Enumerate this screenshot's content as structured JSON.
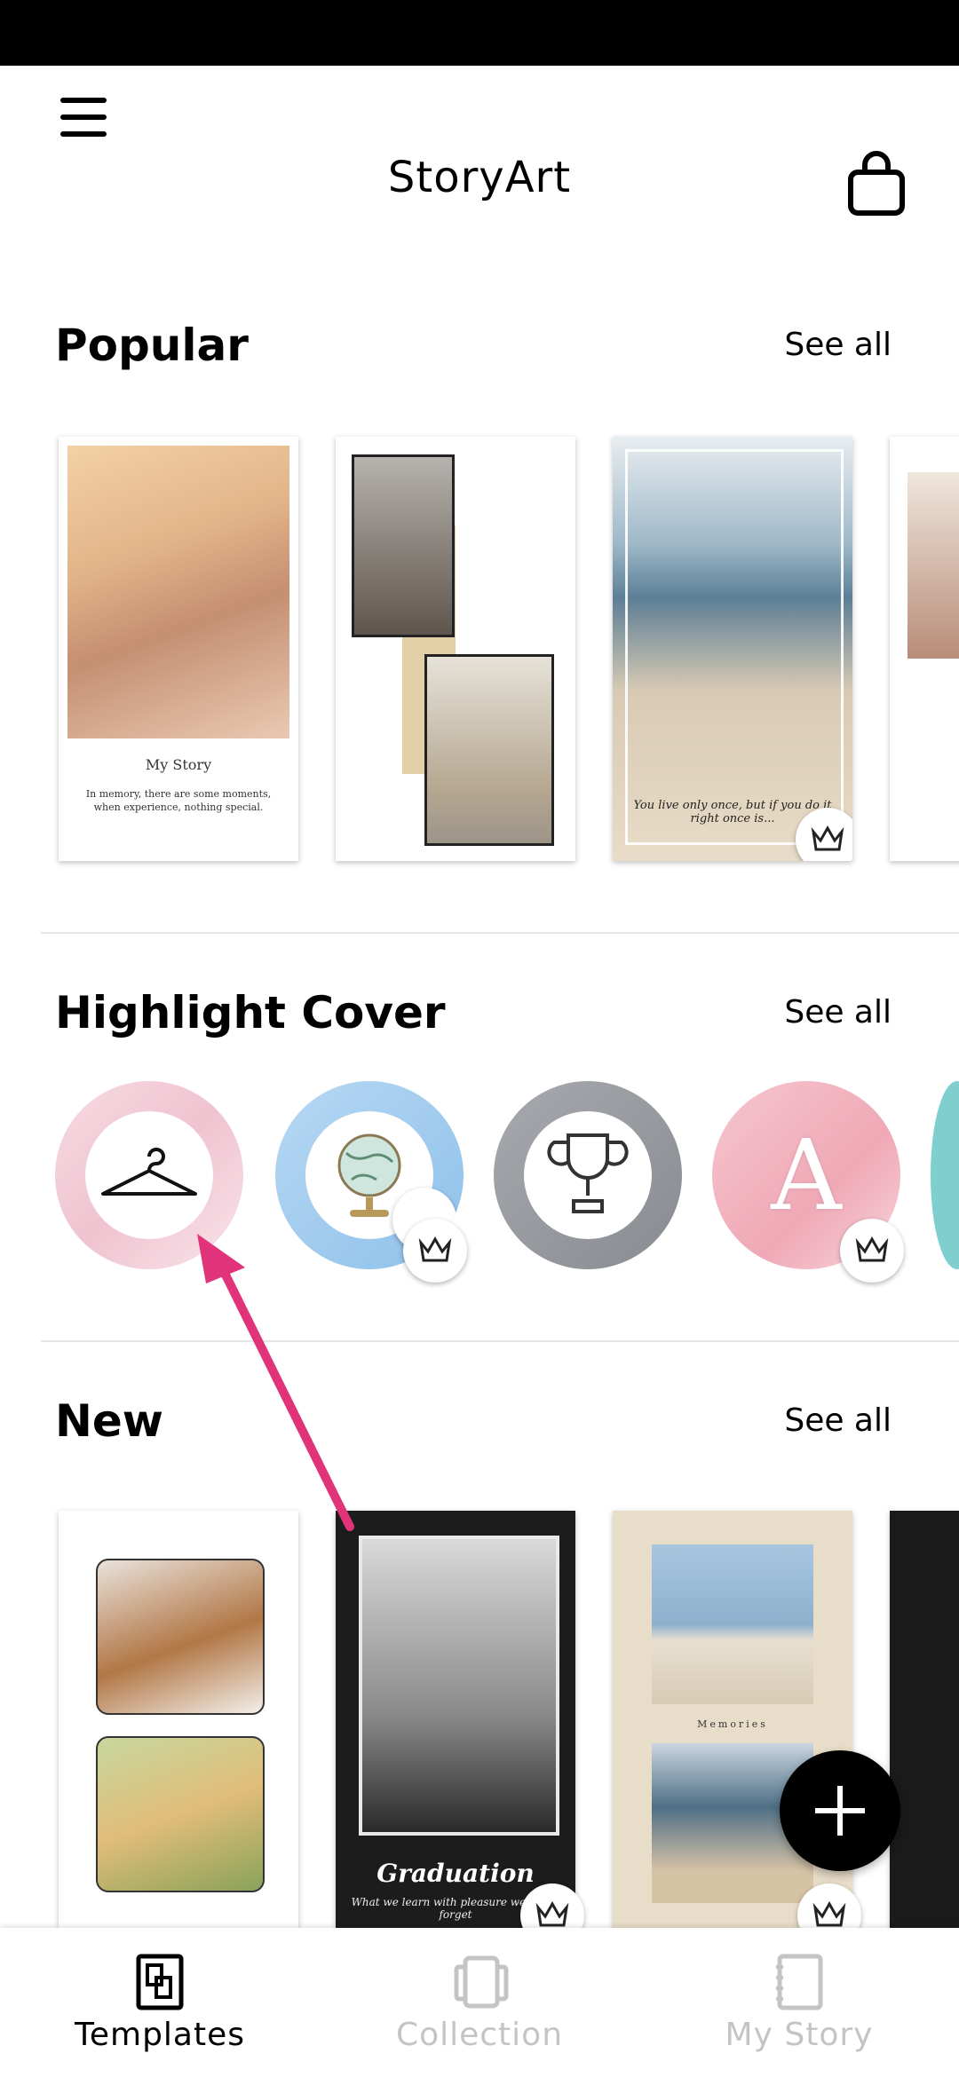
{
  "app": {
    "title": "StoryArt"
  },
  "sections": {
    "popular": {
      "title": "Popular",
      "see_all": "See all"
    },
    "highlight": {
      "title": "Highlight Cover",
      "see_all": "See all"
    },
    "new": {
      "title": "New",
      "see_all": "See all"
    }
  },
  "popular_cards": {
    "card1": {
      "title": "My Story",
      "text": "In memory, there are some moments, when experience, nothing special."
    },
    "card3": {
      "quote": "You live only once, but if you do it right once is..."
    }
  },
  "highlight_covers": [
    {
      "icon": "hanger-icon",
      "ring": "#f3c6d2",
      "premium": false
    },
    {
      "icon": "globe-icon",
      "ring": "#a9cfee",
      "premium": true,
      "label": "The World"
    },
    {
      "icon": "trophy-icon",
      "ring": "#9da0a6",
      "premium": false
    },
    {
      "icon": "letter-icon",
      "ring": "#f2b9c4",
      "premium": true,
      "label": "A"
    }
  ],
  "new_cards": {
    "card2": {
      "title": "Graduation",
      "subtitle": "What we learn with pleasure we never forget"
    },
    "card3": {
      "caption": "Memories"
    }
  },
  "bottom_nav": [
    {
      "label": "Templates",
      "active": true
    },
    {
      "label": "Collection",
      "active": false
    },
    {
      "label": "My Story",
      "active": false
    }
  ],
  "colors": {
    "accent_arrow": "#e0337a",
    "inactive": "#c4c4c4"
  }
}
